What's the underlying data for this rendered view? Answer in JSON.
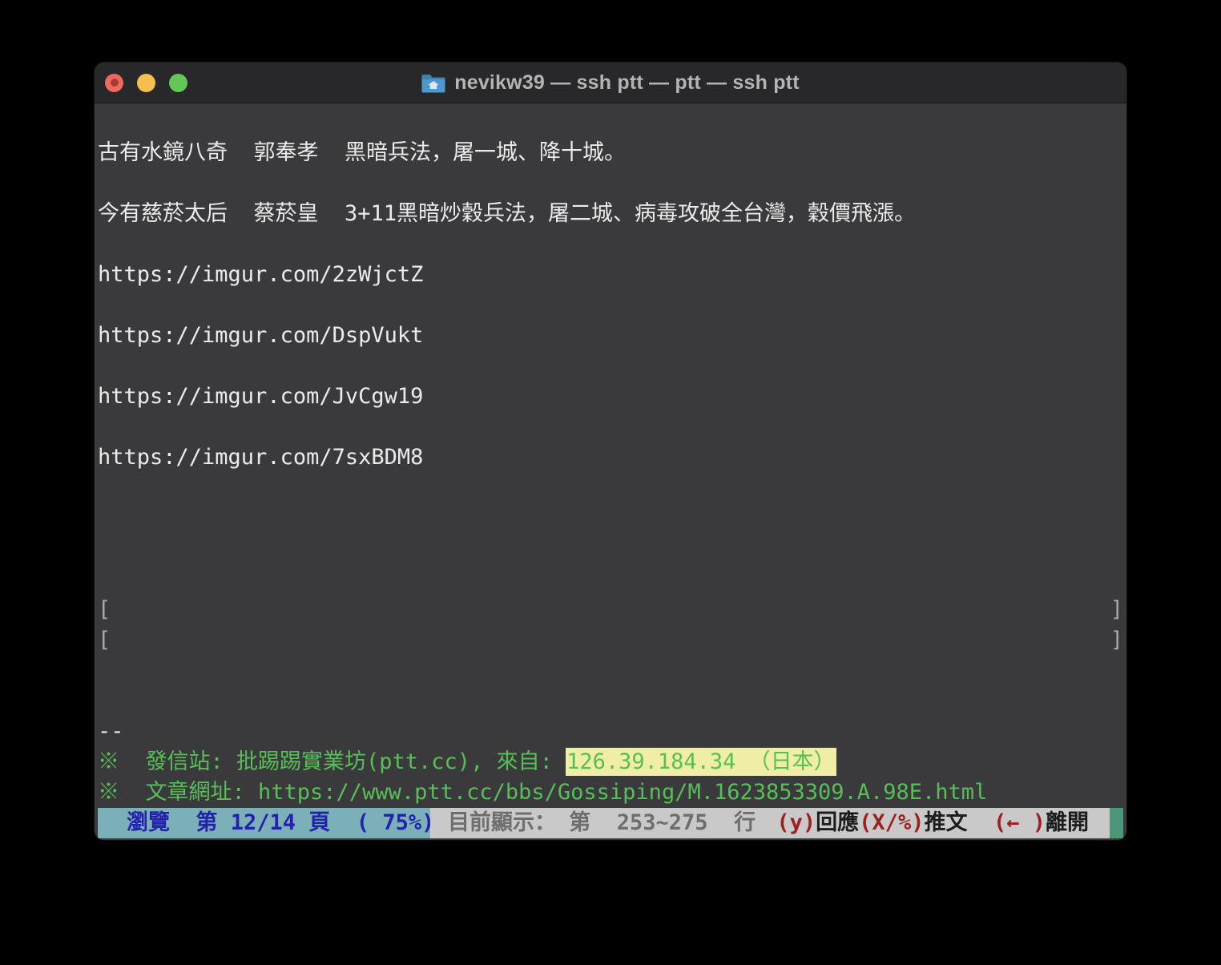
{
  "window": {
    "title": "nevikw39 — ssh ptt — ptt — ssh ptt",
    "proxy_icon": "home-folder-icon",
    "traffic_lights": {
      "close": "close",
      "minimize": "minimize",
      "zoom": "zoom"
    }
  },
  "terminal": {
    "paragraphs": {
      "ancient": "古有水鏡八奇  郭奉孝  黑暗兵法，屠一城、降十城。",
      "modern": "今有慈菸太后  蔡菸皇  3+11黑暗炒穀兵法，屠二城、病毒攻破全台灣，穀價飛漲。"
    },
    "links": [
      "https://imgur.com/2zWjctZ",
      "https://imgur.com/DspVukt",
      "https://imgur.com/JvCgw19",
      "https://imgur.com/7sxBDM8"
    ],
    "bracket_open": "[",
    "bracket_close": "]",
    "dashes": "--",
    "footer": {
      "origin_prefix": "※  發信站: 批踢踢實業坊(ptt.cc), 來自: ",
      "origin_highlight": "126.39.184.34 （日本）",
      "url_line": "※  文章網址: https://www.ptt.cc/bbs/Gossiping/M.1623853309.A.98E.html"
    }
  },
  "status_bar": {
    "browse_label": "瀏覽  第 12/14 頁  ( 75%)",
    "display_label": "目前顯示： 第  253~275  行",
    "actions": [
      {
        "key": "(y)",
        "label": "回應"
      },
      {
        "key": "(X/%)",
        "label": "推文  "
      },
      {
        "key": "(← )",
        "label": "離開"
      }
    ]
  },
  "colors": {
    "terminal_bg": "#3a3a3c",
    "titlebar_bg": "#28282a",
    "text_white": "#ebebeb",
    "text_green": "#58bf58",
    "bracket_gray": "#a9a9a9",
    "highlight_yellow": "#f0eda6",
    "status_teal": "#7bb0b8",
    "status_navy": "#2222ab",
    "status_gray_bg": "#c9c9c9",
    "status_gray_text": "#6e6e6e",
    "status_red": "#9c2020",
    "scroll_green": "#4e9678",
    "traffic_red": "#ec6a5e",
    "traffic_yellow": "#f5bf4f",
    "traffic_green": "#63c758"
  }
}
